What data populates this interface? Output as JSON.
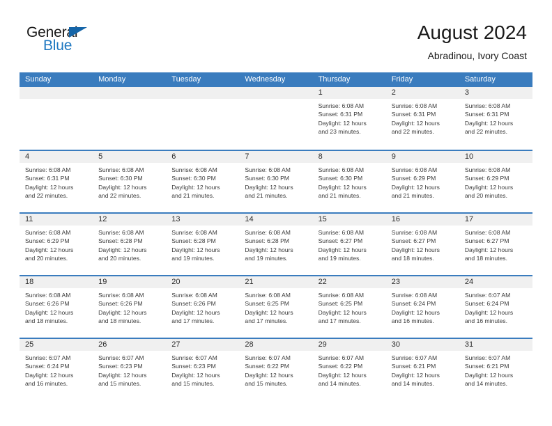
{
  "brand": {
    "line1": "General",
    "line2": "Blue",
    "accent_color": "#1f78c1",
    "triangle_color": "#1565a8"
  },
  "header": {
    "title": "August 2024",
    "subtitle": "Abradinou, Ivory Coast"
  },
  "theme": {
    "header_blue": "#3a7cbe",
    "day_band_gray": "#f0f0f0",
    "text_color": "#3a3a3a"
  },
  "weekdays": [
    "Sunday",
    "Monday",
    "Tuesday",
    "Wednesday",
    "Thursday",
    "Friday",
    "Saturday"
  ],
  "weeks": [
    [
      {
        "day": "",
        "lines": []
      },
      {
        "day": "",
        "lines": []
      },
      {
        "day": "",
        "lines": []
      },
      {
        "day": "",
        "lines": []
      },
      {
        "day": "1",
        "lines": [
          "Sunrise: 6:08 AM",
          "Sunset: 6:31 PM",
          "Daylight: 12 hours",
          "and 23 minutes."
        ]
      },
      {
        "day": "2",
        "lines": [
          "Sunrise: 6:08 AM",
          "Sunset: 6:31 PM",
          "Daylight: 12 hours",
          "and 22 minutes."
        ]
      },
      {
        "day": "3",
        "lines": [
          "Sunrise: 6:08 AM",
          "Sunset: 6:31 PM",
          "Daylight: 12 hours",
          "and 22 minutes."
        ]
      }
    ],
    [
      {
        "day": "4",
        "lines": [
          "Sunrise: 6:08 AM",
          "Sunset: 6:31 PM",
          "Daylight: 12 hours",
          "and 22 minutes."
        ]
      },
      {
        "day": "5",
        "lines": [
          "Sunrise: 6:08 AM",
          "Sunset: 6:30 PM",
          "Daylight: 12 hours",
          "and 22 minutes."
        ]
      },
      {
        "day": "6",
        "lines": [
          "Sunrise: 6:08 AM",
          "Sunset: 6:30 PM",
          "Daylight: 12 hours",
          "and 21 minutes."
        ]
      },
      {
        "day": "7",
        "lines": [
          "Sunrise: 6:08 AM",
          "Sunset: 6:30 PM",
          "Daylight: 12 hours",
          "and 21 minutes."
        ]
      },
      {
        "day": "8",
        "lines": [
          "Sunrise: 6:08 AM",
          "Sunset: 6:30 PM",
          "Daylight: 12 hours",
          "and 21 minutes."
        ]
      },
      {
        "day": "9",
        "lines": [
          "Sunrise: 6:08 AM",
          "Sunset: 6:29 PM",
          "Daylight: 12 hours",
          "and 21 minutes."
        ]
      },
      {
        "day": "10",
        "lines": [
          "Sunrise: 6:08 AM",
          "Sunset: 6:29 PM",
          "Daylight: 12 hours",
          "and 20 minutes."
        ]
      }
    ],
    [
      {
        "day": "11",
        "lines": [
          "Sunrise: 6:08 AM",
          "Sunset: 6:29 PM",
          "Daylight: 12 hours",
          "and 20 minutes."
        ]
      },
      {
        "day": "12",
        "lines": [
          "Sunrise: 6:08 AM",
          "Sunset: 6:28 PM",
          "Daylight: 12 hours",
          "and 20 minutes."
        ]
      },
      {
        "day": "13",
        "lines": [
          "Sunrise: 6:08 AM",
          "Sunset: 6:28 PM",
          "Daylight: 12 hours",
          "and 19 minutes."
        ]
      },
      {
        "day": "14",
        "lines": [
          "Sunrise: 6:08 AM",
          "Sunset: 6:28 PM",
          "Daylight: 12 hours",
          "and 19 minutes."
        ]
      },
      {
        "day": "15",
        "lines": [
          "Sunrise: 6:08 AM",
          "Sunset: 6:27 PM",
          "Daylight: 12 hours",
          "and 19 minutes."
        ]
      },
      {
        "day": "16",
        "lines": [
          "Sunrise: 6:08 AM",
          "Sunset: 6:27 PM",
          "Daylight: 12 hours",
          "and 18 minutes."
        ]
      },
      {
        "day": "17",
        "lines": [
          "Sunrise: 6:08 AM",
          "Sunset: 6:27 PM",
          "Daylight: 12 hours",
          "and 18 minutes."
        ]
      }
    ],
    [
      {
        "day": "18",
        "lines": [
          "Sunrise: 6:08 AM",
          "Sunset: 6:26 PM",
          "Daylight: 12 hours",
          "and 18 minutes."
        ]
      },
      {
        "day": "19",
        "lines": [
          "Sunrise: 6:08 AM",
          "Sunset: 6:26 PM",
          "Daylight: 12 hours",
          "and 18 minutes."
        ]
      },
      {
        "day": "20",
        "lines": [
          "Sunrise: 6:08 AM",
          "Sunset: 6:26 PM",
          "Daylight: 12 hours",
          "and 17 minutes."
        ]
      },
      {
        "day": "21",
        "lines": [
          "Sunrise: 6:08 AM",
          "Sunset: 6:25 PM",
          "Daylight: 12 hours",
          "and 17 minutes."
        ]
      },
      {
        "day": "22",
        "lines": [
          "Sunrise: 6:08 AM",
          "Sunset: 6:25 PM",
          "Daylight: 12 hours",
          "and 17 minutes."
        ]
      },
      {
        "day": "23",
        "lines": [
          "Sunrise: 6:08 AM",
          "Sunset: 6:24 PM",
          "Daylight: 12 hours",
          "and 16 minutes."
        ]
      },
      {
        "day": "24",
        "lines": [
          "Sunrise: 6:07 AM",
          "Sunset: 6:24 PM",
          "Daylight: 12 hours",
          "and 16 minutes."
        ]
      }
    ],
    [
      {
        "day": "25",
        "lines": [
          "Sunrise: 6:07 AM",
          "Sunset: 6:24 PM",
          "Daylight: 12 hours",
          "and 16 minutes."
        ]
      },
      {
        "day": "26",
        "lines": [
          "Sunrise: 6:07 AM",
          "Sunset: 6:23 PM",
          "Daylight: 12 hours",
          "and 15 minutes."
        ]
      },
      {
        "day": "27",
        "lines": [
          "Sunrise: 6:07 AM",
          "Sunset: 6:23 PM",
          "Daylight: 12 hours",
          "and 15 minutes."
        ]
      },
      {
        "day": "28",
        "lines": [
          "Sunrise: 6:07 AM",
          "Sunset: 6:22 PM",
          "Daylight: 12 hours",
          "and 15 minutes."
        ]
      },
      {
        "day": "29",
        "lines": [
          "Sunrise: 6:07 AM",
          "Sunset: 6:22 PM",
          "Daylight: 12 hours",
          "and 14 minutes."
        ]
      },
      {
        "day": "30",
        "lines": [
          "Sunrise: 6:07 AM",
          "Sunset: 6:21 PM",
          "Daylight: 12 hours",
          "and 14 minutes."
        ]
      },
      {
        "day": "31",
        "lines": [
          "Sunrise: 6:07 AM",
          "Sunset: 6:21 PM",
          "Daylight: 12 hours",
          "and 14 minutes."
        ]
      }
    ]
  ]
}
